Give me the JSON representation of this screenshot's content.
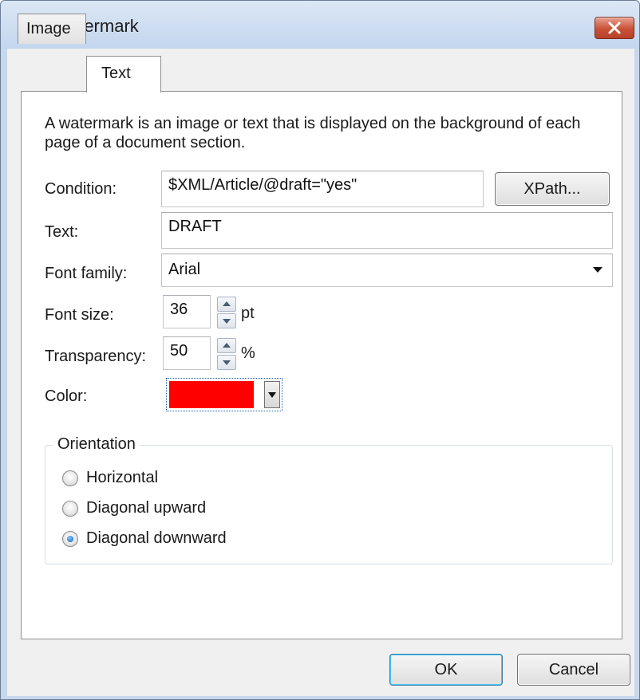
{
  "window": {
    "title": "Edit Watermark"
  },
  "tabs": [
    {
      "label": "Image",
      "active": false
    },
    {
      "label": "Text",
      "active": true
    }
  ],
  "description": "A watermark is an image or text that is displayed on the background of each page of a document section.",
  "condition": {
    "label": "Condition:",
    "value": "$XML/Article/@draft=\"yes\"",
    "button": "XPath..."
  },
  "text_field": {
    "label": "Text:",
    "value": "DRAFT"
  },
  "font_family": {
    "label": "Font family:",
    "value": "Arial"
  },
  "font_size": {
    "label": "Font size:",
    "value": "36",
    "unit": "pt"
  },
  "transparency": {
    "label": "Transparency:",
    "value": "50",
    "unit": "%"
  },
  "color": {
    "label": "Color:",
    "value": "#ff0000"
  },
  "orientation": {
    "legend": "Orientation",
    "options": [
      {
        "label": "Horizontal",
        "checked": false
      },
      {
        "label": "Diagonal upward",
        "checked": false
      },
      {
        "label": "Diagonal downward",
        "checked": true
      }
    ]
  },
  "buttons": {
    "ok": "OK",
    "cancel": "Cancel"
  }
}
